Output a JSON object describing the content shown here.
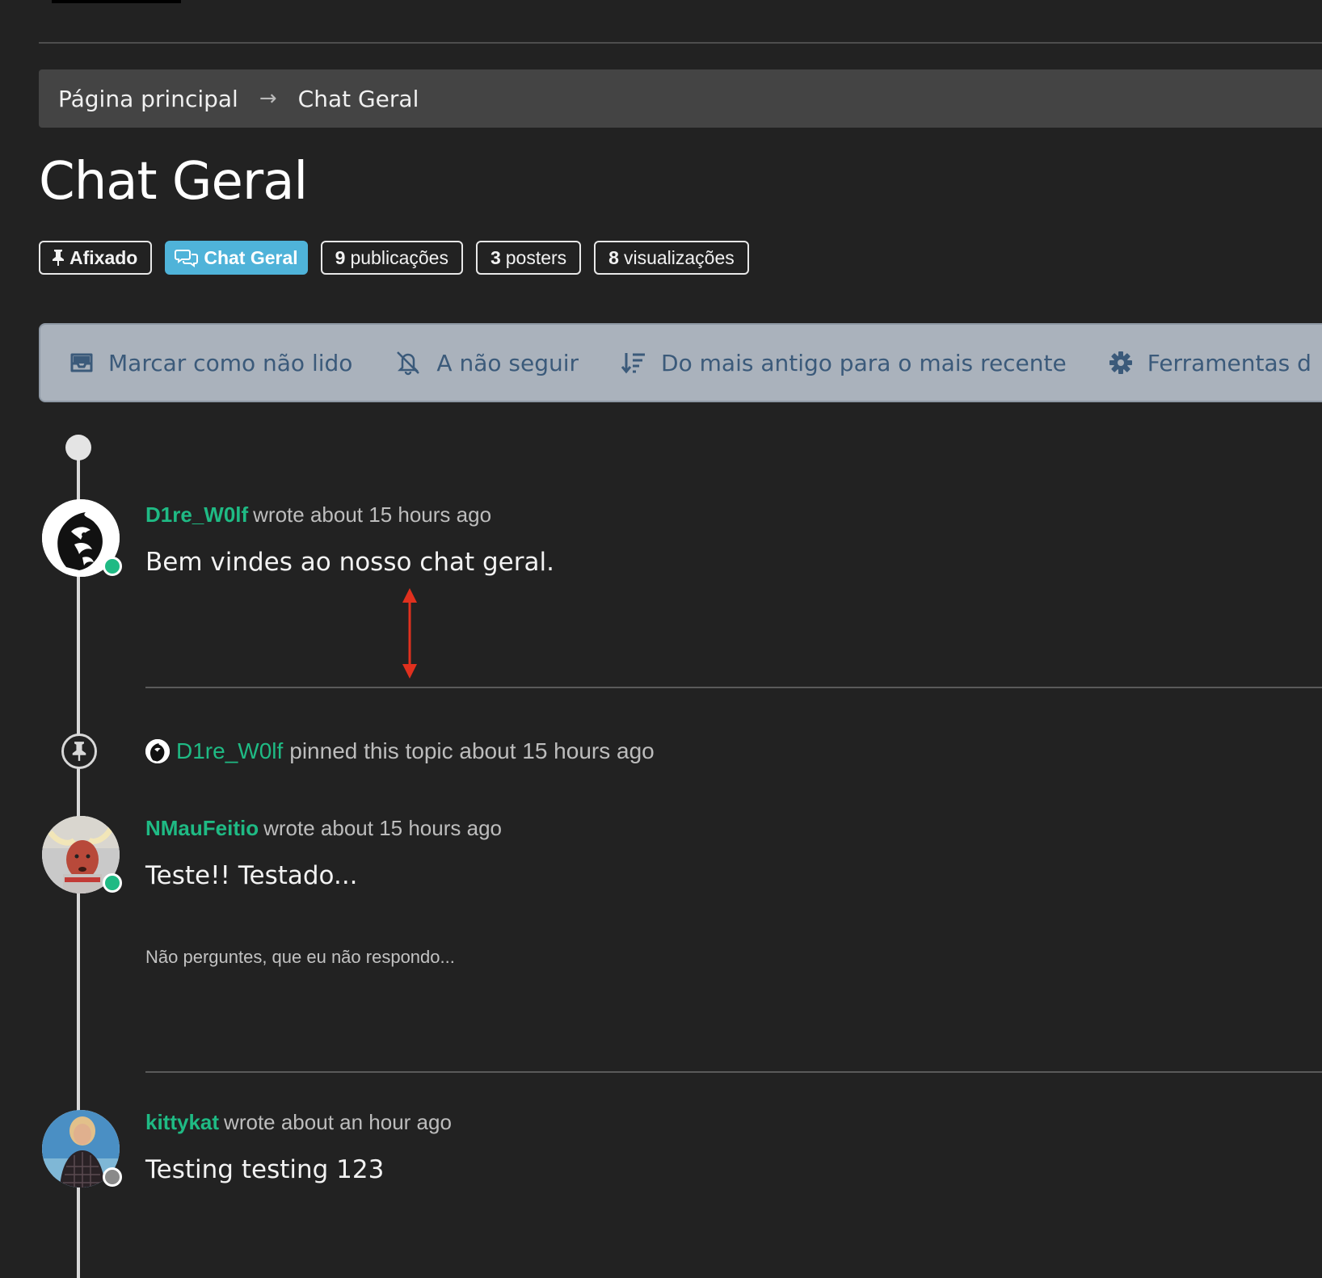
{
  "breadcrumb": {
    "home": "Página principal",
    "current": "Chat Geral"
  },
  "title": "Chat Geral",
  "tags": {
    "pinned": "Afixado",
    "category": "Chat Geral",
    "posts_count": "9",
    "posts_label": "publicações",
    "posters_count": "3",
    "posters_label": "posters",
    "views_count": "8",
    "views_label": "visualizações"
  },
  "toolbar": {
    "mark_unread": "Marcar como não lido",
    "unfollow": "A não seguir",
    "sort": "Do mais antigo para o mais recente",
    "tools": "Ferramentas d"
  },
  "posts": [
    {
      "user": "D1re_W0lf",
      "meta": "wrote about 15 hours ago",
      "body": "Bem vindes ao nosso chat geral.",
      "status": "online"
    },
    {
      "user": "NMauFeitio",
      "meta": "wrote about 15 hours ago",
      "body": "Teste!! Testado...",
      "signature": "Não perguntes, que eu não respondo...",
      "status": "online"
    },
    {
      "user": "kittykat",
      "meta": "wrote about an hour ago",
      "body": "Testing testing 123",
      "status": "offline"
    }
  ],
  "event": {
    "user": "D1re_W0lf",
    "text": "pinned this topic about 15 hours ago"
  },
  "colors": {
    "background": "#222222",
    "accent_user": "#1fba84",
    "category_badge": "#4fb3d9",
    "toolbar_bg": "#aab2bc",
    "toolbar_text": "#3b5a7a",
    "online": "#1fba84",
    "offline": "#8a8a8a",
    "annotation": "#e0301e"
  }
}
